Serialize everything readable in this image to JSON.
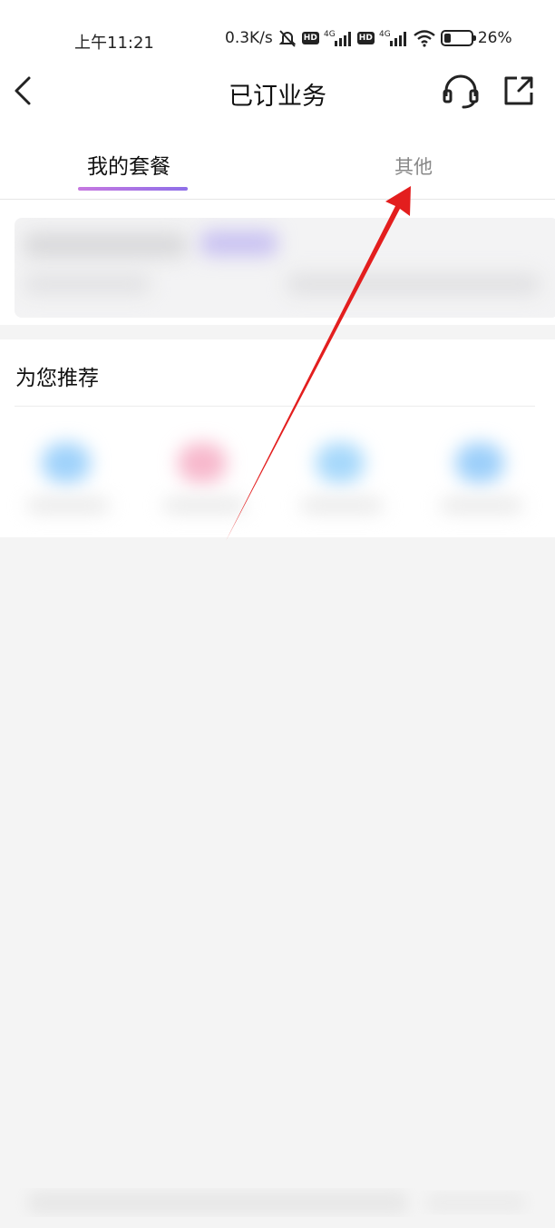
{
  "status_bar": {
    "time": "上午11:21",
    "speed": "0.3K/s",
    "hd": "HD",
    "network": "4G",
    "battery": "26%",
    "battery_level": 0.26
  },
  "nav": {
    "title": "已订业务",
    "icons": [
      "back-icon",
      "headset-icon",
      "share-icon"
    ]
  },
  "tabs": [
    {
      "label": "我的套餐",
      "active": true
    },
    {
      "label": "其他",
      "active": false
    }
  ],
  "recommend": {
    "title": "为您推荐"
  },
  "colors": {
    "tab_indicator_start": "#c678e0",
    "tab_indicator_end": "#8e6fe8",
    "arrow": "#e31e1e",
    "page_bg": "#f4f4f4"
  }
}
